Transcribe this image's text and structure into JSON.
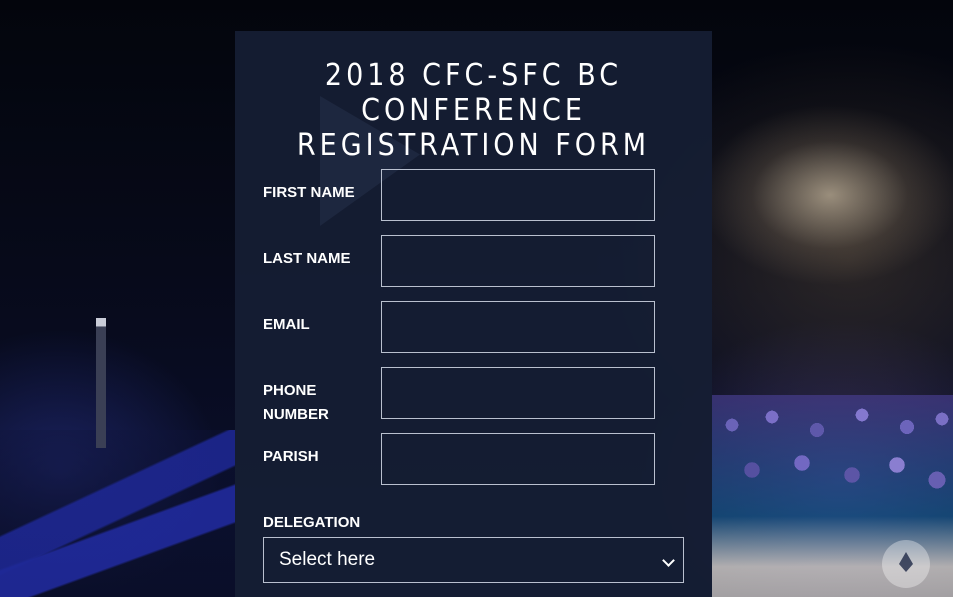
{
  "form": {
    "title_lines": [
      "2018 CFC-SFC BC",
      "CONFERENCE",
      "REGISTRATION FORM"
    ],
    "fields": [
      {
        "label": "FIRST NAME",
        "value": ""
      },
      {
        "label": "LAST NAME",
        "value": ""
      },
      {
        "label": "EMAIL",
        "value": ""
      },
      {
        "label": "PHONE NUMBER",
        "value": ""
      },
      {
        "label": "PARISH",
        "value": ""
      }
    ],
    "delegation": {
      "label": "DELEGATION",
      "selected": "Select here"
    }
  },
  "icons": {
    "select_arrow": "chevron-down-icon",
    "watermark": "logo-badge-icon"
  },
  "colors": {
    "card_background": "#161e34",
    "text": "#ffffff",
    "input_border": "#b9c0cf"
  }
}
